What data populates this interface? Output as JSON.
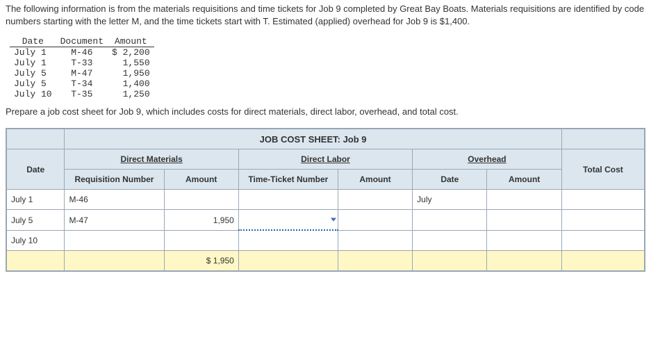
{
  "intro": "The following information is from the materials requisitions and time tickets for Job 9 completed by Great Bay Boats. Materials requisitions are identified by code numbers starting with the letter M, and the time tickets start with T. Estimated (applied) overhead for Job 9 is $1,400.",
  "source_table": {
    "headers": [
      "Date",
      "Document",
      "Amount"
    ],
    "rows": [
      {
        "date": "July 1",
        "doc": "M-46",
        "amount": "$ 2,200"
      },
      {
        "date": "July 1",
        "doc": "T-33",
        "amount": "1,550"
      },
      {
        "date": "July 5",
        "doc": "M-47",
        "amount": "1,950"
      },
      {
        "date": "July 5",
        "doc": "T-34",
        "amount": "1,400"
      },
      {
        "date": "July 10",
        "doc": "T-35",
        "amount": "1,250"
      }
    ]
  },
  "prep_line": "Prepare a job cost sheet for Job 9, which includes costs for direct materials, direct labor, overhead, and total cost.",
  "jcs": {
    "title": "JOB COST SHEET: Job 9",
    "group_headers": {
      "date": "Date",
      "dm": "Direct Materials",
      "dl": "Direct Labor",
      "oh": "Overhead",
      "total": "Total Cost"
    },
    "col_headers": {
      "req_no": "Requisition Number",
      "dm_amount": "Amount",
      "tt_no": "Time-Ticket Number",
      "dl_amount": "Amount",
      "oh_date": "Date",
      "oh_amount": "Amount"
    },
    "rows": [
      {
        "date": "July 1",
        "req": "M-46",
        "dm_amt": "",
        "tt": "",
        "dl_amt": "",
        "oh_date": "July",
        "oh_amt": ""
      },
      {
        "date": "July 5",
        "req": "M-47",
        "dm_amt": "1,950",
        "tt": "",
        "dl_amt": "",
        "oh_date": "",
        "oh_amt": ""
      },
      {
        "date": "July 10",
        "req": "",
        "dm_amt": "",
        "tt": "",
        "dl_amt": "",
        "oh_date": "",
        "oh_amt": ""
      }
    ],
    "totals": {
      "dm": "$   1,950",
      "dl": "",
      "oh": "",
      "total": ""
    }
  }
}
